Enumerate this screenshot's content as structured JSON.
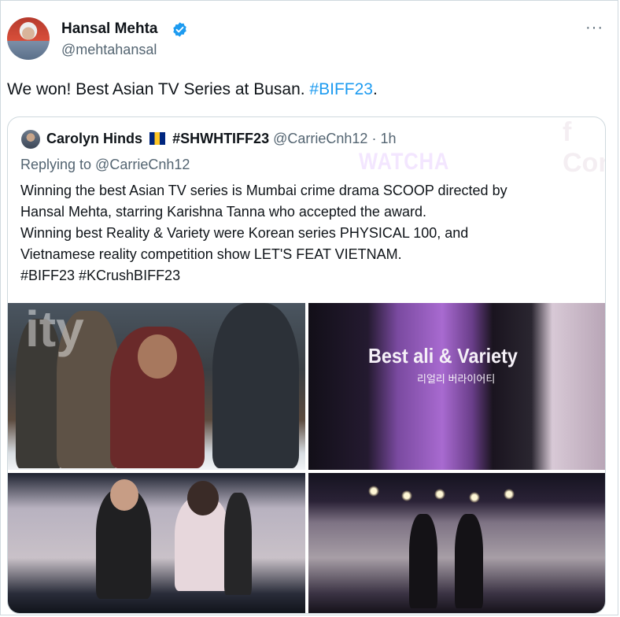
{
  "author": {
    "name": "Hansal Mehta",
    "handle": "@mehtahansal",
    "verified_icon": "verified-badge-icon",
    "avatar_icon": "avatar"
  },
  "more_menu": "···",
  "tweet": {
    "text": "We won! Best Asian TV Series at Busan. ",
    "hashtag": "#BIFF23",
    "end": "."
  },
  "quote": {
    "name": "Carolyn Hinds",
    "flag_icon": "barbados-flag-icon",
    "name_tag": "#SHWHTIFF23",
    "handle": "@CarrieCnh12",
    "separator": "·",
    "time": "1h",
    "replying_to": "Replying to @CarrieCnh12",
    "lines": [
      "Winning the best Asian TV series is Mumbai crime drama SCOOP directed by",
      "Hansal Mehta, starring Karishna Tanna who accepted the award.",
      "Winning best Reality & Variety were Korean series PHYSICAL 100, and",
      "Vietnamese reality competition show LET'S FEAT VIETNAM.",
      "#BIFF23 #KCrushBIFF23"
    ],
    "media": {
      "image2_sign": "WATCHA",
      "image2_backdrop": "f Con",
      "image4_title": "Best  ali   & Variety",
      "image4_subtitle": "리얼리    버라이어티",
      "image3_backdrop": "ity"
    }
  },
  "colors": {
    "link": "#1d9bf0",
    "secondary_text": "#536471",
    "border": "#cfd9de",
    "verified": "#1d9bf0"
  }
}
